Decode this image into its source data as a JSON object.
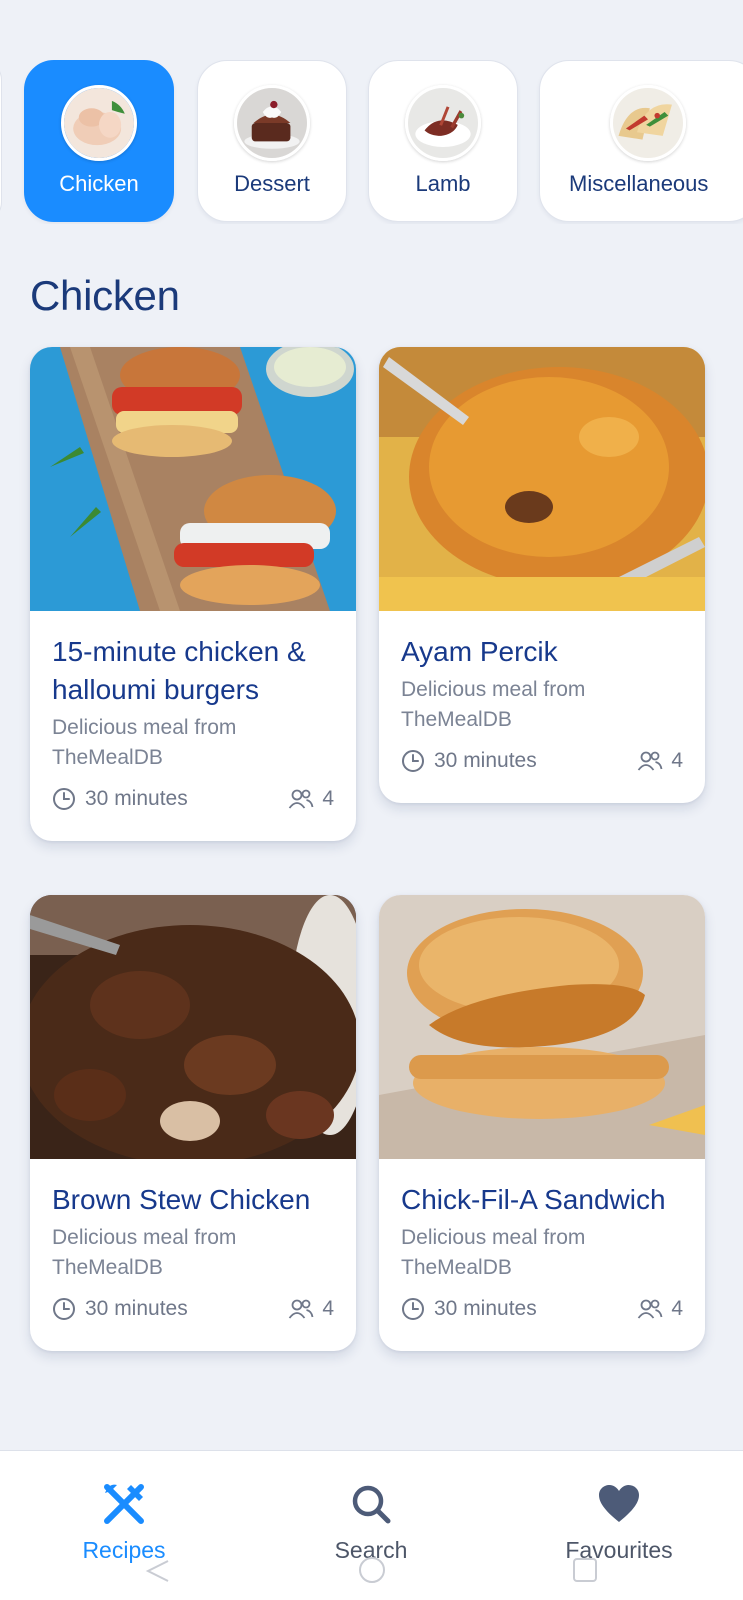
{
  "categories": [
    {
      "label": "Chicken",
      "icon": "chicken-thumb",
      "active": true
    },
    {
      "label": "Dessert",
      "icon": "dessert-thumb",
      "active": false
    },
    {
      "label": "Lamb",
      "icon": "lamb-thumb",
      "active": false
    },
    {
      "label": "Miscellaneous",
      "icon": "miscellaneous-thumb",
      "active": false
    }
  ],
  "section_title": "Chicken",
  "recipes": [
    {
      "title": "15-minute chicken & halloumi burgers",
      "subtitle": "Delicious meal from TheMealDB",
      "time": "30 minutes",
      "servings": "4",
      "image": "halloumi-burgers-photo"
    },
    {
      "title": "Ayam Percik",
      "subtitle": "Delicious meal from TheMealDB",
      "time": "30 minutes",
      "servings": "4",
      "image": "ayam-percik-photo"
    },
    {
      "title": "Brown Stew Chicken",
      "subtitle": "Delicious meal from TheMealDB",
      "time": "30 minutes",
      "servings": "4",
      "image": "brown-stew-photo"
    },
    {
      "title": "Chick-Fil-A Sandwich",
      "subtitle": "Delicious meal from TheMealDB",
      "time": "30 minutes",
      "servings": "4",
      "image": "chick-fil-a-photo"
    }
  ],
  "nav": {
    "recipes_label": "Recipes",
    "search_label": "Search",
    "favourites_label": "Favourites",
    "active": "recipes"
  },
  "colors": {
    "accent": "#1a8cff",
    "title": "#17398c",
    "background": "#eef1f7",
    "muted": "#7b8394",
    "nav_icon": "#4d5b78"
  }
}
